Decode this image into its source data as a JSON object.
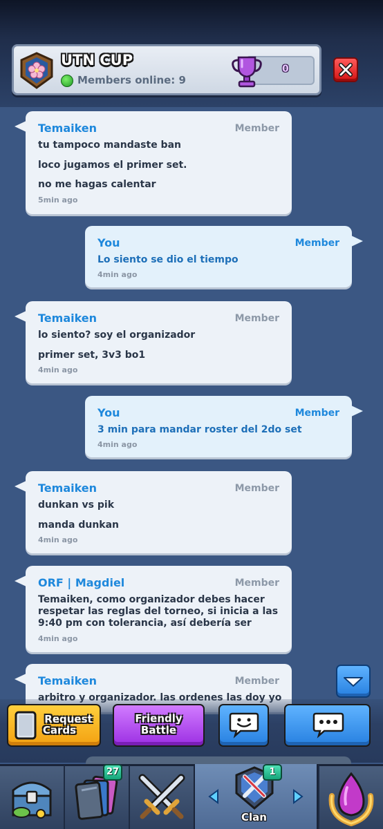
{
  "header": {
    "clan_name": "UTN CUP",
    "members_online": "Members online: 9",
    "trophies": "0",
    "badge_icon": "clan-badge-flower-icon",
    "trophy_icon": "purple-trophy-icon",
    "close_icon": "close-x-icon"
  },
  "messages": [
    {
      "sender": "Temaiken",
      "role": "Member",
      "lines": [
        "tu tampoco mandaste ban",
        "loco jugamos el primer set.",
        "no me hagas calentar"
      ],
      "time": "5min ago",
      "side": "left"
    },
    {
      "sender": "You",
      "role": "Member",
      "lines": [
        "Lo siento se dio el tiempo"
      ],
      "time": "4min ago",
      "side": "right"
    },
    {
      "sender": "Temaiken",
      "role": "Member",
      "lines": [
        "lo siento? soy el organizador",
        "primer set, 3v3 bo1"
      ],
      "time": "4min ago",
      "side": "left"
    },
    {
      "sender": "You",
      "role": "Member",
      "lines": [
        "3 min para mandar roster del 2do set"
      ],
      "time": "4min ago",
      "side": "right"
    },
    {
      "sender": "Temaiken",
      "role": "Member",
      "lines": [
        "dunkan vs pik",
        "manda dunkan"
      ],
      "time": "4min ago",
      "side": "left"
    },
    {
      "sender": "ORF | Magdiel",
      "role": "Member",
      "lines": [
        "Temaiken, como organizador debes hacer",
        "respetar las reglas del torneo, si inicia a las",
        "9:40 pm con tolerancia, así debería ser"
      ],
      "time": "4min ago",
      "side": "left"
    },
    {
      "sender": "Temaiken",
      "role": "Member",
      "lines": [
        "arbitro y organizador. las ordenes las doy yo"
      ],
      "time": "",
      "side": "left"
    }
  ],
  "actions": {
    "request_cards": [
      "Request",
      "Cards"
    ],
    "friendly_battle": [
      "Friendly",
      "Battle"
    ],
    "emote_icon": "emote-face-icon",
    "chat_icon": "chat-bubble-icon"
  },
  "nav": {
    "cards_badge": "27",
    "clan_badge": "1",
    "clan_label": "Clan",
    "icons": [
      "shop-chest-icon",
      "cards-icon",
      "battle-swords-icon",
      "clan-crossed-swords-icon",
      "events-gem-icon"
    ]
  },
  "colors": {
    "background": "#3b5783",
    "sender_blue": "#1e88dc",
    "request_yellow": "#f3a111",
    "battle_purple": "#9c2fe3",
    "button_blue": "#2780e0"
  }
}
